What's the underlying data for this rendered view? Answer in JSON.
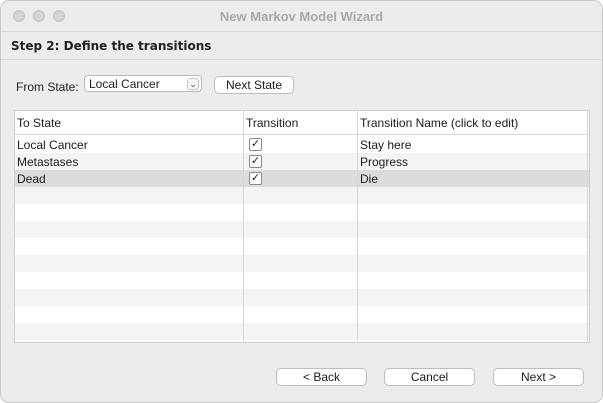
{
  "window": {
    "title": "New Markov Model Wizard"
  },
  "header": {
    "step_title": "Step 2: Define the transitions"
  },
  "from_state": {
    "label": "From State:",
    "selected": "Local Cancer",
    "next_button": "Next State"
  },
  "table": {
    "columns": [
      "To State",
      "Transition",
      "Transition Name (click to edit)"
    ],
    "rows": [
      {
        "to_state": "Local Cancer",
        "checked": true,
        "name": "Stay here"
      },
      {
        "to_state": "Metastases",
        "checked": true,
        "name": "Progress"
      },
      {
        "to_state": "Dead",
        "checked": true,
        "name": "Die"
      }
    ],
    "selected_row": 2
  },
  "footer": {
    "back": "< Back",
    "cancel": "Cancel",
    "next": "Next >"
  }
}
